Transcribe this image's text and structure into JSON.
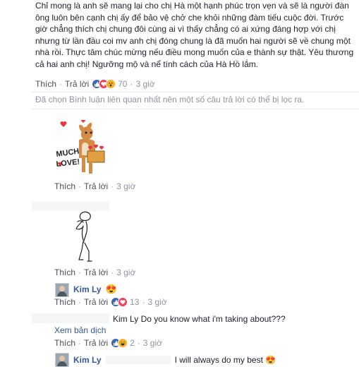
{
  "comment_main": {
    "text": "Chỉ mong là anh sẽ mang lại cho chị Hà một hạnh phúc trọn vẹn và sẽ là người đàn ông luôn bên cạnh chị ấy để bảo vệ chở che khỏi những đàm tiếu cuộc đời. Trước giờ chẳng thích chị chung đôi cùng ai vì thấy chẳng có ai xứng đáng hợp với chị nhưng từ lần đầu coi mv anh chị đóng chung là đã muốn hai người sẽ về chung một nhà rồi. Thực tâm chúc mừng nếu điều mong muốn của e thành sự thật. Yêu thương cả hai anh chị! Ngưỡng mộ và nể tính cách của Hà Hồ lắm.",
    "like_label": "Thích",
    "reply_label": "Trả lời",
    "reaction_count": "70",
    "time": "3 giờ"
  },
  "filter_note": "Đã chọn Bình luận liên quan nhất nên một số câu trả lời có thể bị lọc ra.",
  "reply_sticker_1": {
    "sticker_text": "MUCH LOVE!",
    "like_label": "Thích",
    "reply_label": "Trả lời",
    "time": "3 giờ"
  },
  "reply_sticker_2": {
    "like_label": "Thích",
    "reply_label": "Trả lời",
    "time": "3 giờ"
  },
  "reply_kimly_1": {
    "name": "Kim Ly",
    "emoji": "😍",
    "like_label": "Thích",
    "reply_label": "Trả lời",
    "reaction_count": "13",
    "time": "3 giờ"
  },
  "reply_question": {
    "text": "Kim Ly Do you know what i'm taking about???",
    "see_translation": "Xem bản dịch",
    "like_label": "Thích",
    "reply_label": "Trả lời",
    "reaction_count": "2",
    "time": "3 giờ"
  },
  "reply_kimly_2": {
    "name": "Kim Ly",
    "text": "I will always do my best 😍"
  },
  "colors": {
    "link": "#365899",
    "meta": "#90949c",
    "like": "#4267b2",
    "love": "#f33e58",
    "wow": "#f7b125"
  }
}
